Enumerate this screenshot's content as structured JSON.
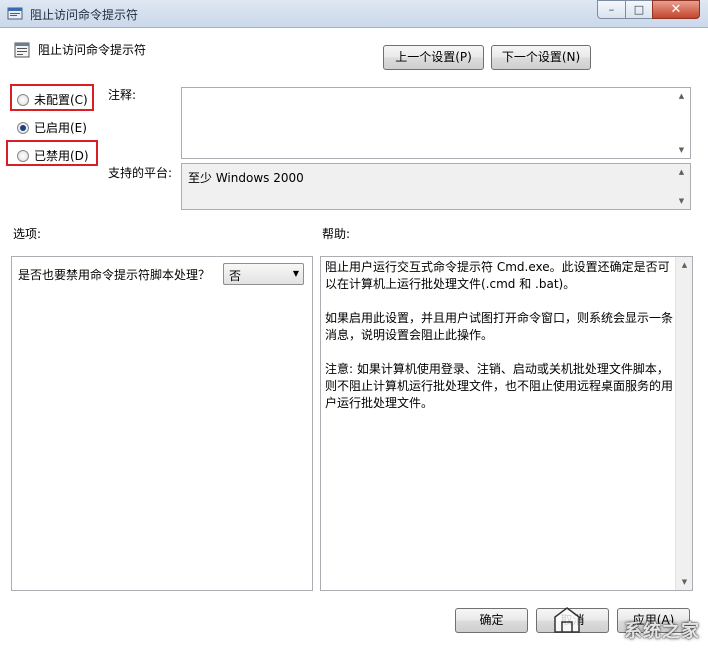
{
  "window": {
    "title": "阻止访问命令提示符",
    "min_glyph": "–",
    "max_glyph": "□",
    "close_glyph": "✕"
  },
  "header": {
    "policy_title": "阻止访问命令提示符",
    "prev_button": "上一个设置(P)",
    "next_button": "下一个设置(N)"
  },
  "state": {
    "options": [
      {
        "label": "未配置(C)",
        "checked": false
      },
      {
        "label": "已启用(E)",
        "checked": true
      },
      {
        "label": "已禁用(D)",
        "checked": false
      }
    ]
  },
  "comment": {
    "label": "注释:",
    "value": ""
  },
  "platform": {
    "label": "支持的平台:",
    "value": "至少 Windows 2000"
  },
  "options_section": {
    "label": "选项:",
    "question": "是否也要禁用命令提示符脚本处理？",
    "select_value": "否"
  },
  "help_section": {
    "label": "帮助:",
    "paragraphs": [
      "阻止用户运行交互式命令提示符 Cmd.exe。此设置还确定是否可以在计算机上运行批处理文件(.cmd 和 .bat)。",
      "如果启用此设置，并且用户试图打开命令窗口，则系统会显示一条消息，说明设置会阻止此操作。",
      "注意: 如果计算机使用登录、注销、启动或关机批处理文件脚本，则不阻止计算机运行批处理文件，也不阻止使用远程桌面服务的用户运行批处理文件。"
    ]
  },
  "footer": {
    "ok_button": "确定",
    "cancel_button": "取消",
    "apply_button": "应用(A)"
  },
  "watermark": "系统之家",
  "colors": {
    "highlight_box": "#d91f26",
    "radio_dot": "#1d3f83"
  }
}
